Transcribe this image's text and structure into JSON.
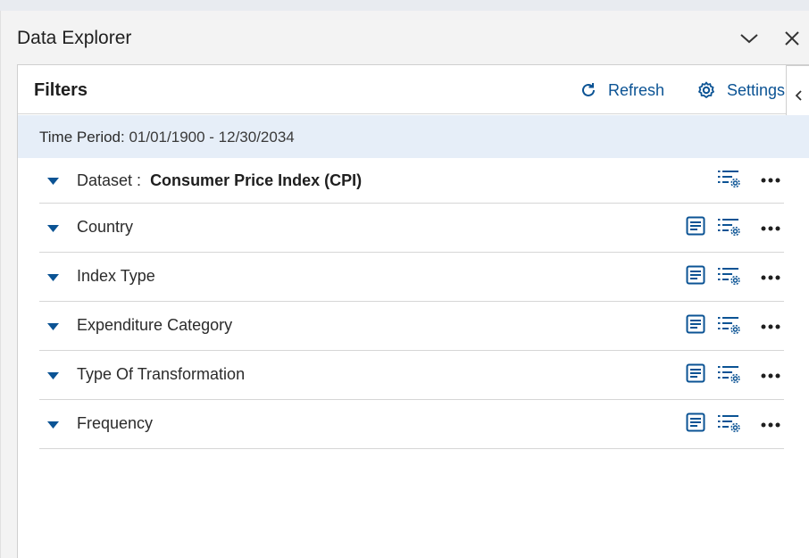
{
  "panel": {
    "title": "Data Explorer",
    "collapse_icon": "chevron-down-icon",
    "close_icon": "close-icon"
  },
  "filters": {
    "title": "Filters",
    "refresh_label": "Refresh",
    "settings_label": "Settings",
    "collapse_tab_icon": "chevron-left-icon"
  },
  "time_period": {
    "label": "Time Period:",
    "value": "01/01/1900 - 12/30/2034"
  },
  "dataset": {
    "label": "Dataset :",
    "value": "Consumer Price Index (CPI)"
  },
  "rows": [
    {
      "label": "Country"
    },
    {
      "label": "Index Type"
    },
    {
      "label": "Expenditure Category"
    },
    {
      "label": "Type Of Transformation"
    },
    {
      "label": "Frequency"
    }
  ],
  "colors": {
    "accent": "#0b5394",
    "time_row_bg": "#e6eef8",
    "panel_bg": "#f3f3f3"
  }
}
